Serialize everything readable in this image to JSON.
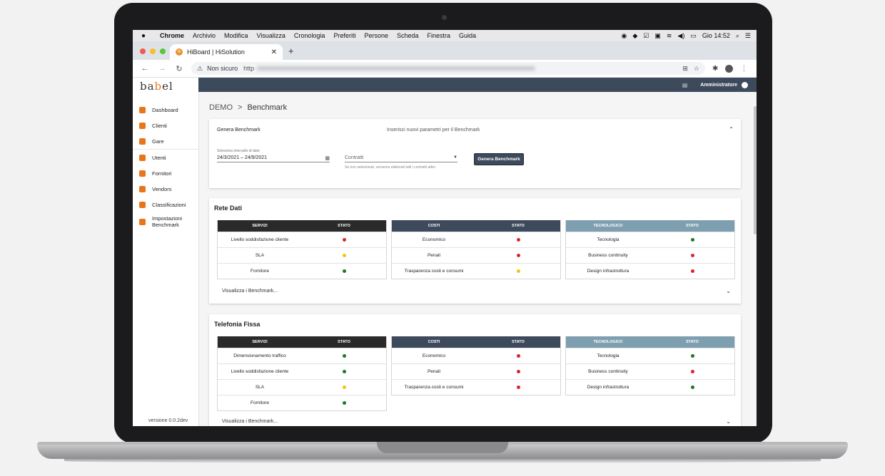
{
  "menubar": {
    "apple": "",
    "items": [
      "Chrome",
      "Archivio",
      "Modifica",
      "Visualizza",
      "Cronologia",
      "Preferiti",
      "Persone",
      "Scheda",
      "Finestra",
      "Guida"
    ],
    "clock": "Gio 14:52"
  },
  "browser": {
    "tab_title": "HiBoard | HiSolution",
    "tab_favicon": "hi",
    "security": "Non sicuro",
    "url_prefix": "http"
  },
  "sidebar": {
    "logo_prefix": "ba",
    "logo_mid": "b",
    "logo_suffix": "el",
    "items": [
      {
        "label": "Dashboard"
      },
      {
        "label": "Clienti"
      },
      {
        "label": "Gare"
      },
      {
        "label": "Utenti"
      },
      {
        "label": "Fornitori"
      },
      {
        "label": "Vendors"
      },
      {
        "label": "Classificazioni"
      },
      {
        "label_line1": "Impostazioni",
        "label_line2": "Benchmark"
      }
    ],
    "version": "versione 0.0.2dev"
  },
  "topbar": {
    "user": "Amministratore"
  },
  "breadcrumb": {
    "root": "DEMO",
    "separator": ">",
    "current": "Benchmark"
  },
  "generate": {
    "title": "Genera Benchmark",
    "subtitle": "Inserisci nuovi parametri per il Benchmark",
    "date_label": "Seleziona intervallo di date",
    "date_value": "24/3/2021 – 24/9/2021",
    "contracts_placeholder": "Contratti",
    "contracts_hint": "Se non selezionati, verranno elaborati tutti i contratti attivi",
    "button": "Genera Benchmark"
  },
  "sections": [
    {
      "title": "Rete Dati",
      "view_link": "Visualizza i Benchmark...",
      "tables": [
        {
          "header": "SERVIZI",
          "status_header": "STATO",
          "rows": [
            {
              "label": "Livello soddisfazione cliente",
              "status": "red"
            },
            {
              "label": "SLA",
              "status": "yellow"
            },
            {
              "label": "Fornitore",
              "status": "green"
            }
          ]
        },
        {
          "header": "COSTI",
          "status_header": "STATO",
          "rows": [
            {
              "label": "Economico",
              "status": "red"
            },
            {
              "label": "Penali",
              "status": "red"
            },
            {
              "label": "Trasparenza costi e consumi",
              "status": "yellow"
            }
          ]
        },
        {
          "header": "TECNOLOGICO",
          "status_header": "STATO",
          "rows": [
            {
              "label": "Tecnologia",
              "status": "green"
            },
            {
              "label": "Business continuity",
              "status": "red"
            },
            {
              "label": "Design infrastruttura",
              "status": "red"
            }
          ]
        }
      ]
    },
    {
      "title": "Telefonia Fissa",
      "view_link": "Visualizza i Benchmark...",
      "tables": [
        {
          "header": "SERVIZI",
          "status_header": "STATO",
          "rows": [
            {
              "label": "Dimensionamento traffico",
              "status": "green"
            },
            {
              "label": "Livello soddisfazione cliente",
              "status": "green"
            },
            {
              "label": "SLA",
              "status": "yellow"
            },
            {
              "label": "Fornitore",
              "status": "green"
            }
          ]
        },
        {
          "header": "COSTI",
          "status_header": "STATO",
          "rows": [
            {
              "label": "Economico",
              "status": "red"
            },
            {
              "label": "Penali",
              "status": "red"
            },
            {
              "label": "Trasparenza costi e consumi",
              "status": "red"
            }
          ]
        },
        {
          "header": "TECNOLOGICO",
          "status_header": "STATO",
          "rows": [
            {
              "label": "Tecnologia",
              "status": "green"
            },
            {
              "label": "Business continuity",
              "status": "red"
            },
            {
              "label": "Design infrastruttura",
              "status": "green"
            }
          ]
        }
      ]
    }
  ],
  "colors": {
    "topbar": "#3c4a5c",
    "accent": "#e8751a",
    "red": "#d62828",
    "yellow": "#f2c40f",
    "green": "#1e7a1e"
  }
}
